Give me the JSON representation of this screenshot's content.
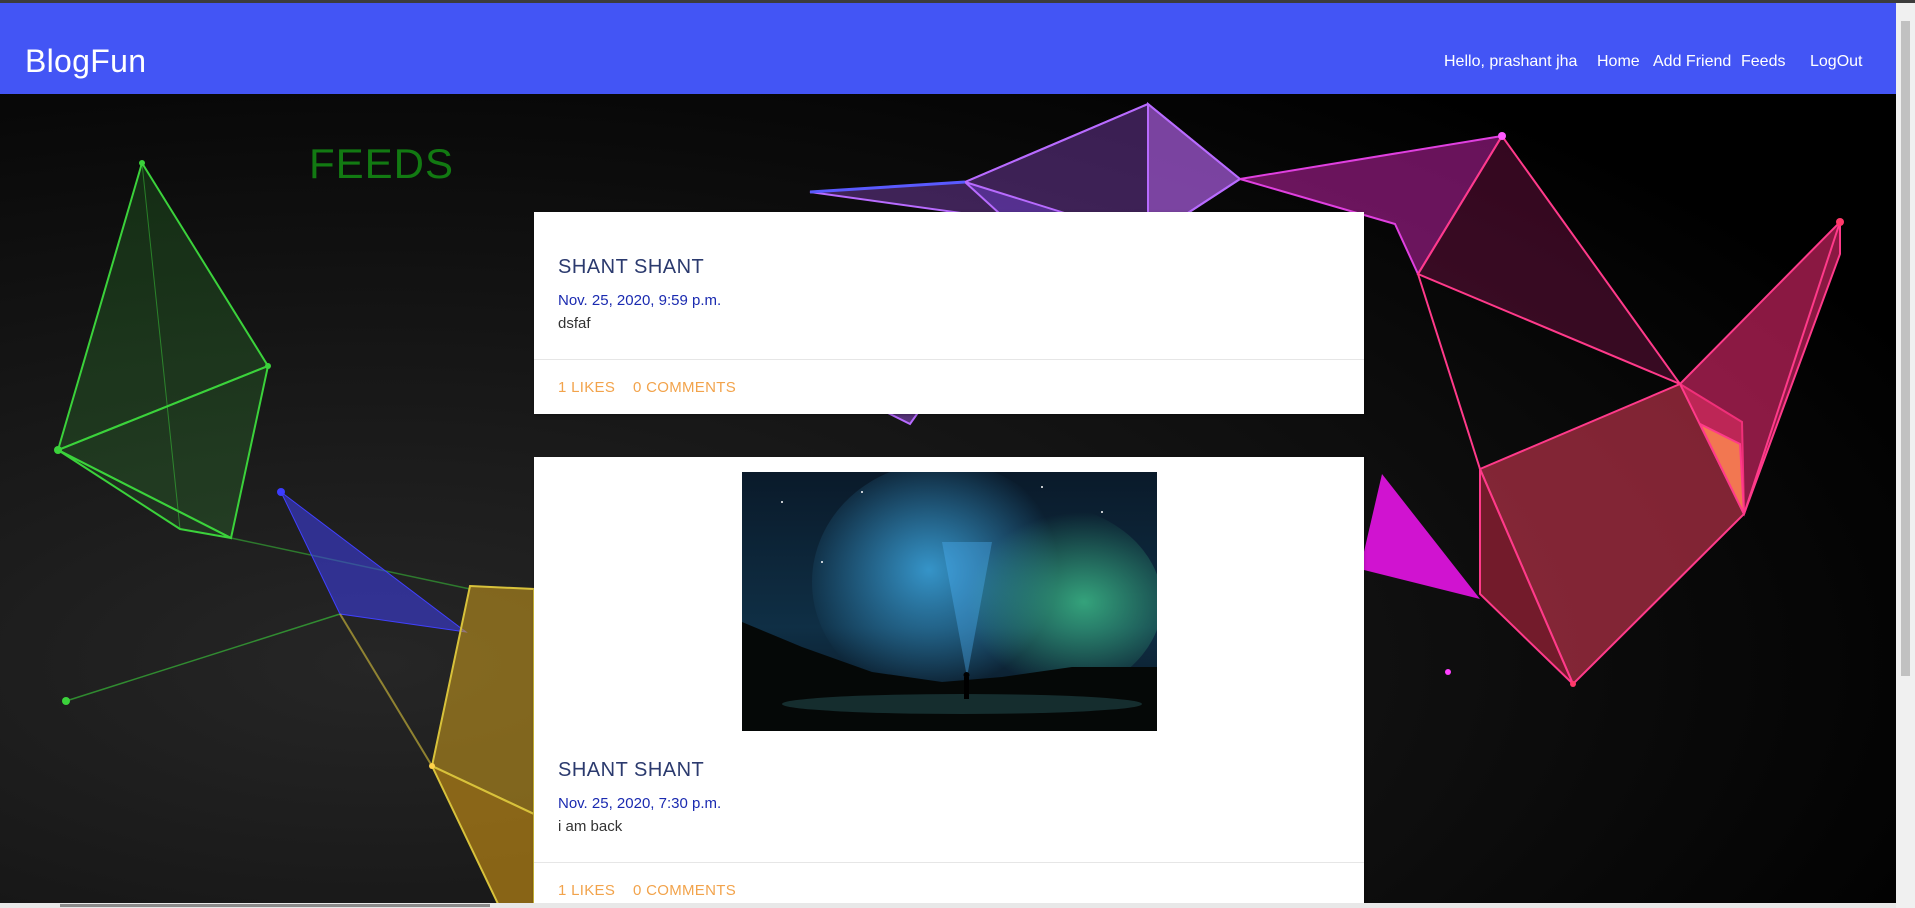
{
  "navbar": {
    "brand": "BlogFun",
    "greeting": "Hello, prashant jha",
    "links": [
      "Home",
      "Add Friend",
      "Feeds",
      "LogOut"
    ]
  },
  "page": {
    "title": "FEEDS"
  },
  "posts": [
    {
      "author": "SHANT SHANT",
      "date": "Nov. 25, 2020, 9:59 p.m.",
      "text": "dsfaf",
      "likes": "1 LIKES",
      "comments": "0 COMMENTS",
      "has_image": false
    },
    {
      "author": "SHANT SHANT",
      "date": "Nov. 25, 2020, 7:30 p.m.",
      "text": "i am back",
      "likes": "1 LIKES",
      "comments": "0 COMMENTS",
      "has_image": true,
      "image": "aurora-night-sky-photo"
    }
  ],
  "colors": {
    "navbar": "#4355f5",
    "feeds_title": "#127a12",
    "date": "#1a2ab0",
    "action": "#f2a34b"
  }
}
